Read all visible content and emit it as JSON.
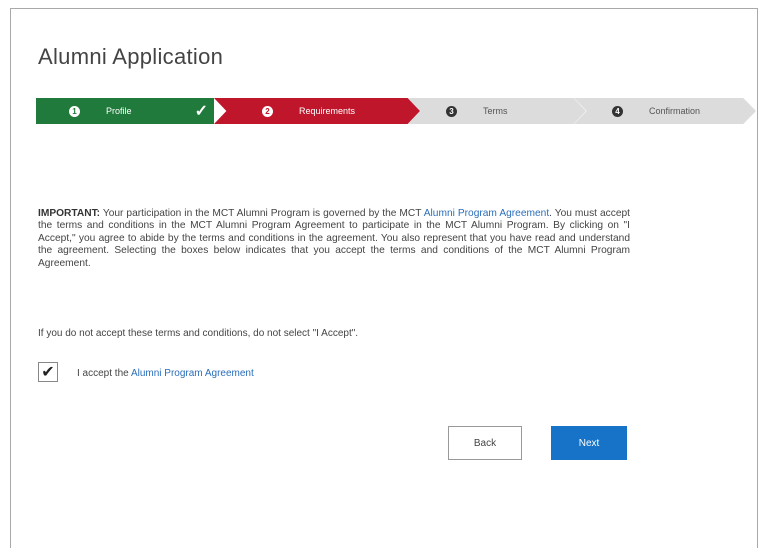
{
  "page": {
    "title": "Alumni Application"
  },
  "steps": [
    {
      "num": "1",
      "label": "Profile",
      "state": "completed",
      "color": "#1f7a3b"
    },
    {
      "num": "2",
      "label": "Requirements",
      "state": "current",
      "color": "#c0162c"
    },
    {
      "num": "3",
      "label": "Terms",
      "state": "upcoming",
      "color": "#dcdcdc"
    },
    {
      "num": "4",
      "label": "Confirmation",
      "state": "upcoming",
      "color": "#dcdcdc"
    }
  ],
  "legal": {
    "important": "IMPORTANT:",
    "text_1": " Your participation in the MCT Alumni Program is governed by the MCT ",
    "link_1": "Alumni Program Agreement",
    "text_2": ". You must accept the terms and conditions in the MCT Alumni Program Agreement to participate in the MCT Alumni Program. By clicking on \"I Accept,\" you agree to abide by the terms and conditions in the agreement. You also represent that you have read and understand the agreement. Selecting the boxes below indicates that you accept the terms and conditions of the MCT Alumni Program Agreement."
  },
  "note": "If you do not accept these terms and conditions, do not select \"I Accept\".",
  "accept": {
    "checked": true,
    "text": "I accept the ",
    "link": "Alumni Program Agreement"
  },
  "buttons": {
    "back": "Back",
    "next": "Next"
  },
  "icons": {
    "check": "checkmark-icon"
  }
}
